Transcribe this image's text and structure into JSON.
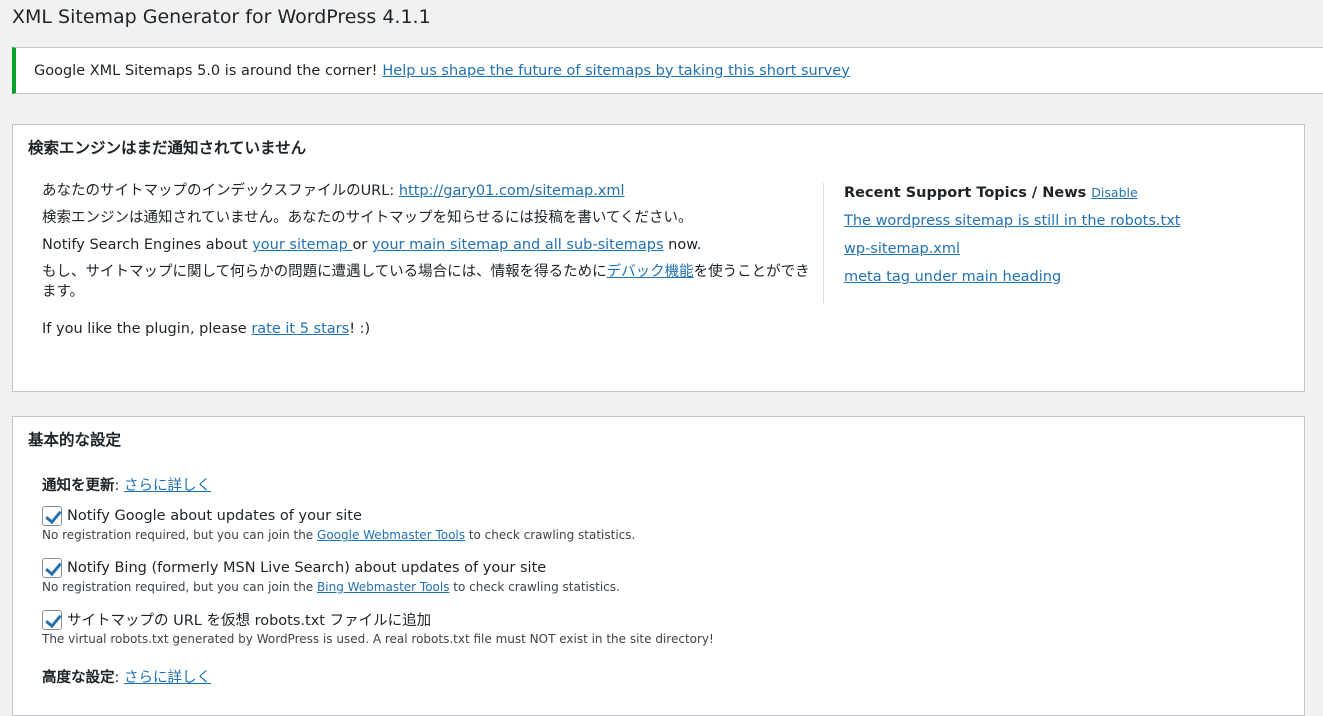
{
  "page": {
    "title": "XML Sitemap Generator for WordPress 4.1.1"
  },
  "notice": {
    "message": "Google XML Sitemaps 5.0 is around the corner!",
    "link": "Help us shape the future of sitemaps by taking this short survey"
  },
  "status_box": {
    "title": "検索エンジンはまだ通知されていません",
    "url_prefix": "あなたのサイトマップのインデックスファイルのURL: ",
    "url_link": "http://gary01.com/sitemap.xml",
    "not_notified": "検索エンジンは通知されていません。あなたのサイトマップを知らせるには投稿を書いてください。",
    "notify_prefix": "Notify Search Engines about ",
    "notify_link1": "your sitemap ",
    "notify_or": "or ",
    "notify_link2": "your main sitemap and all sub-sitemaps",
    "notify_suffix": " now.",
    "debug_prefix": "もし、サイトマップに関して何らかの問題に遭遇している場合には、情報を得るために",
    "debug_link": "デバック機能",
    "debug_suffix": "を使うことができます。",
    "rate_prefix": "If you like the plugin, please ",
    "rate_link": "rate it 5 stars",
    "rate_suffix": "! :)"
  },
  "support": {
    "heading": "Recent Support Topics / News ",
    "disable": "Disable",
    "topics": [
      "The wordpress sitemap is still in the robots.txt",
      "wp-sitemap.xml",
      "meta tag under main heading"
    ]
  },
  "basic_box": {
    "title": "基本的な設定",
    "update_label": "通知を更新",
    "update_link": "さらに詳しく",
    "options": [
      {
        "label": "Notify Google about updates of your site",
        "checked": true,
        "desc_prefix": "No registration required, but you can join the ",
        "desc_link": "Google Webmaster Tools",
        "desc_suffix": " to check crawling statistics."
      },
      {
        "label": "Notify Bing (formerly MSN Live Search) about updates of your site",
        "checked": true,
        "desc_prefix": "No registration required, but you can join the ",
        "desc_link": "Bing Webmaster Tools",
        "desc_suffix": " to check crawling statistics."
      },
      {
        "label": "サイトマップの URL を仮想 robots.txt ファイルに追加",
        "checked": true,
        "desc_prefix": "The virtual robots.txt generated by WordPress is used. A real robots.txt file must NOT exist in the site directory!"
      }
    ],
    "advanced_label": "高度な設定",
    "advanced_link": "さらに詳しく"
  },
  "colors": {
    "accent": "#2271b1",
    "success": "#00a32a",
    "border": "#c3c4c7"
  }
}
